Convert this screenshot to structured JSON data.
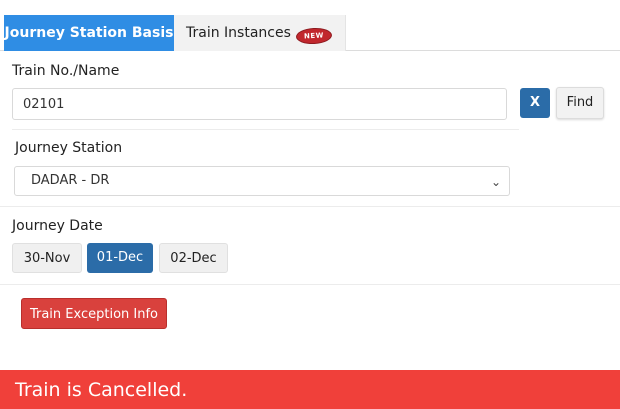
{
  "tabs": [
    {
      "label": "Journey Station Basis",
      "active": true
    },
    {
      "label": "Train Instances",
      "badge": "NEW",
      "active": false
    }
  ],
  "train": {
    "label": "Train No./Name",
    "value": "02101",
    "clear_label": "X",
    "find_label": "Find"
  },
  "station": {
    "label": "Journey Station",
    "selected": "DADAR - DR"
  },
  "date": {
    "label": "Journey Date",
    "options": [
      "30-Nov",
      "01-Dec",
      "02-Dec"
    ],
    "selected": "01-Dec"
  },
  "exception_button": "Train Exception Info",
  "status_message": "Train is Cancelled.",
  "colors": {
    "primary": "#2f8de4",
    "selected": "#2b6ca8",
    "danger": "#d9413d",
    "alert": "#f0403a"
  }
}
